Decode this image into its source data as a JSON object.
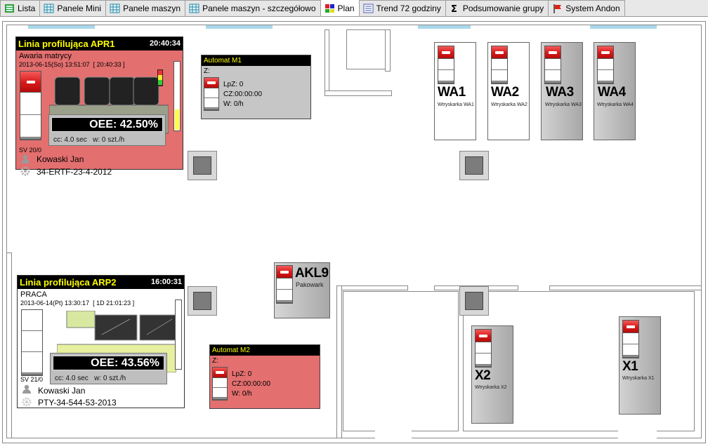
{
  "tabs": [
    {
      "label": "Lista",
      "icon": "list-icon"
    },
    {
      "label": "Panele Mini",
      "icon": "grid-icon"
    },
    {
      "label": "Panele maszyn",
      "icon": "grid-icon"
    },
    {
      "label": "Panele maszyn - szczegółowo",
      "icon": "grid-icon"
    },
    {
      "label": "Plan",
      "icon": "plan-icon",
      "active": true
    },
    {
      "label": "Trend 72 godziny",
      "icon": "trend-icon"
    },
    {
      "label": "Podsumowanie grupy",
      "icon": "sigma-icon"
    },
    {
      "label": "System Andon",
      "icon": "flag-icon"
    }
  ],
  "lines": {
    "apr1": {
      "title": "Linia profilująca APR1",
      "time": "20:40:34",
      "status": "Awaria matrycy",
      "since": "2013-06-15(So) 13:51:07",
      "duration": "[ 20:40:33 ]",
      "oee": "OEE: 42.50%",
      "cc": "cc: 4.0 sec",
      "w": "w: 0 szt./h",
      "sv": "SV 20/0",
      "operator": "Kowaski Jan",
      "order": "34-ERTF-23-4-2012",
      "color": "#e36f6f",
      "level": 0.3
    },
    "arp2": {
      "title": "Linia profilująca ARP2",
      "time": "16:00:31",
      "status": "PRACA",
      "since": "2013-06-14(Pt) 13:30:17",
      "duration": "[ 1D 21:01:23 ]",
      "oee": "OEE: 43.56%",
      "cc": "cc: 4.0 sec",
      "w": "w: 0 szt./h",
      "sv": "SV 21/0",
      "operator": "Kowaski Jan",
      "order": "PTY-34-544-53-2013",
      "color": "#ffffff"
    }
  },
  "automats": {
    "m1": {
      "title": "Automat M1",
      "z": "Z:",
      "lpz": "LpZ: 0",
      "cz": "CZ:00:00:00",
      "w": "W: 0/h",
      "color": "#c6c6c6"
    },
    "m2": {
      "title": "Automat M2",
      "z": "Z:",
      "lpz": "LpZ: 0",
      "cz": "CZ:00:00:00",
      "w": "W: 0/h",
      "color": "#e36f6f"
    }
  },
  "machines": {
    "wa1": {
      "name": "WA1",
      "label": "Wtryskarka WA1"
    },
    "wa2": {
      "name": "WA2",
      "label": "Wtryskarka WA2"
    },
    "wa3": {
      "name": "WA3",
      "label": "Wtryskarka WA3"
    },
    "wa4": {
      "name": "WA4",
      "label": "Wtryskarka WA4"
    },
    "akl9": {
      "name": "AKL9",
      "label": "Pakowark"
    },
    "x2": {
      "name": "X2",
      "label": "Wtryskarka X2"
    },
    "x1": {
      "name": "X1",
      "label": "Wtryskarka X1"
    }
  }
}
